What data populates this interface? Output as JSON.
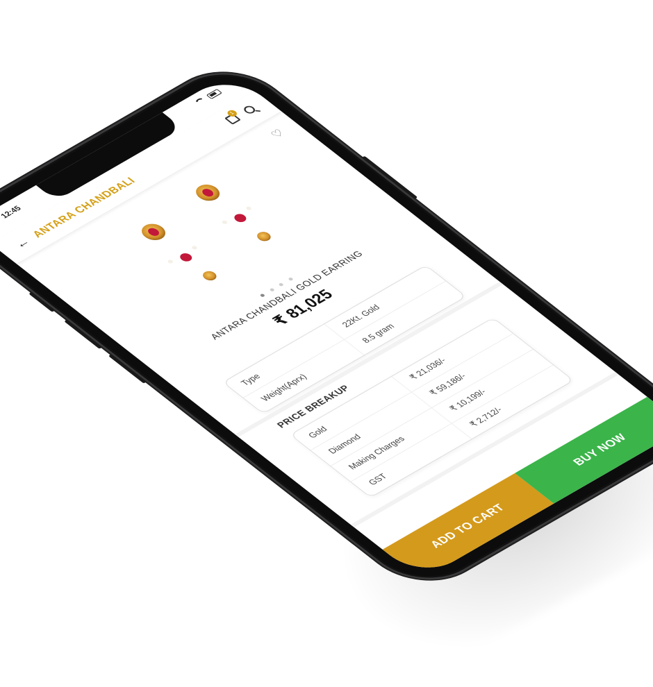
{
  "status_bar": {
    "time": "12:45"
  },
  "app_bar": {
    "title": "ANTARA CHANDBALI",
    "cart_count": "1"
  },
  "product": {
    "name": "ANTARA CHANDBALI GOLD EARRING",
    "price": "₹ 81,025"
  },
  "specs": [
    {
      "label": "Type",
      "value": "22Kt. Gold"
    },
    {
      "label": "Weight(Aprx)",
      "value": "8.5 gram"
    }
  ],
  "price_breakup": {
    "title": "PRICE BREAKUP",
    "rows": [
      {
        "label": "Gold",
        "value": "₹ 21,036/-"
      },
      {
        "label": "Diamond",
        "value": "₹ 59,186/-"
      },
      {
        "label": "Making Charges",
        "value": "₹ 10,199/-"
      },
      {
        "label": "GST",
        "value": "₹ 2,712/-"
      }
    ]
  },
  "actions": {
    "add_to_cart": "ADD TO CART",
    "buy_now": "BUY NOW"
  },
  "colors": {
    "gold": "#d49a1c",
    "green": "#3bb44a",
    "title": "#d4a017"
  }
}
